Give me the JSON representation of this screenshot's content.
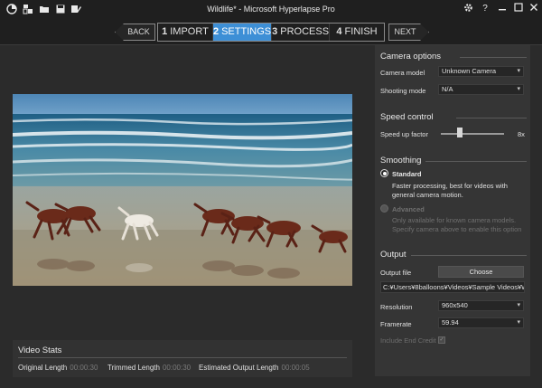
{
  "window": {
    "title": "Wildlife* - Microsoft Hyperlapse Pro",
    "left_icons": [
      "app-logo-icon",
      "scenes-icon",
      "folder-open-icon",
      "save-icon",
      "save-as-icon"
    ],
    "right_icons": [
      "gear-icon",
      "help-icon",
      "minimize-icon",
      "maximize-icon",
      "close-icon"
    ]
  },
  "nav": {
    "back_label": "BACK",
    "next_label": "NEXT",
    "steps": [
      {
        "num": "1",
        "label": "IMPORT"
      },
      {
        "num": "2",
        "label": "SETTINGS"
      },
      {
        "num": "3",
        "label": "PROCESS"
      },
      {
        "num": "4",
        "label": "FINISH"
      }
    ],
    "active_step": 2
  },
  "video_stats": {
    "title": "Video Stats",
    "original_label": "Original Length",
    "original_value": "00:00:30",
    "trimmed_label": "Trimmed Length",
    "trimmed_value": "00:00:30",
    "estimated_label": "Estimated Output Length",
    "estimated_value": "00:00:05"
  },
  "camera_options": {
    "title": "Camera options",
    "model_label": "Camera model",
    "model_value": "Unknown Camera",
    "mode_label": "Shooting mode",
    "mode_value": "N/A"
  },
  "speed_control": {
    "title": "Speed control",
    "factor_label": "Speed up factor",
    "factor_value": "8x",
    "slider_fraction": 0.3
  },
  "smoothing": {
    "title": "Smoothing",
    "standard_label": "Standard",
    "standard_desc": "Faster processing, best for videos with general camera motion.",
    "advanced_label": "Advanced",
    "advanced_desc": "Only available for known camera models. Specify camera above to enable this option",
    "selected": "Standard"
  },
  "output": {
    "title": "Output",
    "file_label": "Output file",
    "choose_label": "Choose",
    "path": "C:¥Users¥8balloons¥Videos¥Sample Videos¥Wil",
    "resolution_label": "Resolution",
    "resolution_value": "960x540",
    "framerate_label": "Framerate",
    "framerate_value": "59.94",
    "credit_label": "Include End Credit",
    "credit_checked": true
  },
  "colors": {
    "accent": "#3d8fd6",
    "window_bg": "#2b2b2b",
    "panel_bg": "#353535"
  }
}
